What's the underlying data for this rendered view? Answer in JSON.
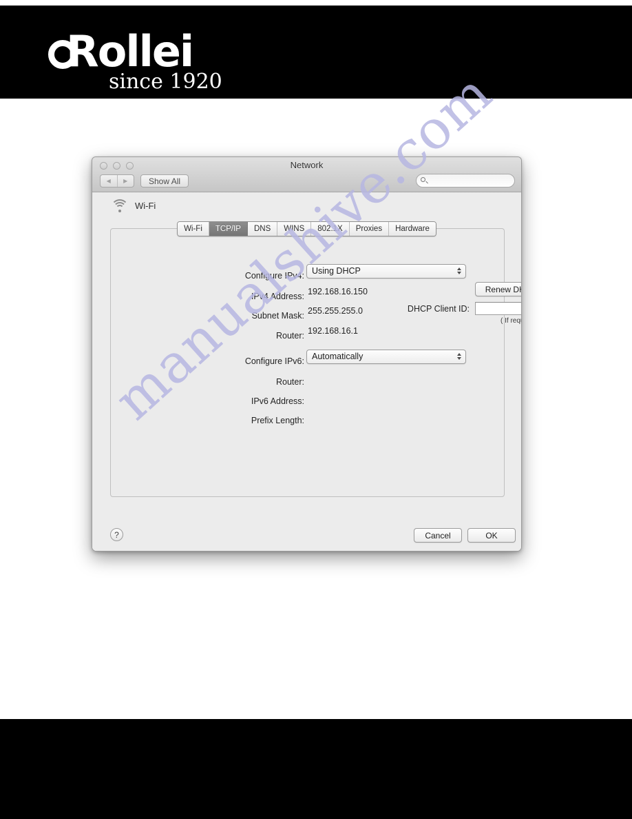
{
  "brand": {
    "logo_word": "Rollei",
    "logo_tagline": "since 1920"
  },
  "watermark": {
    "text": "manualshive.com",
    "color": "#b7b7e2"
  },
  "window": {
    "title": "Network",
    "traffic_lights": [
      "close",
      "minimize",
      "zoom"
    ],
    "toolbar": {
      "back_label": "◀",
      "forward_label": "▶",
      "show_all_label": "Show All",
      "search_value": "",
      "search_placeholder": ""
    },
    "service": {
      "name": "Wi-Fi",
      "icon": "wifi-icon"
    },
    "tabs": [
      {
        "label": "Wi-Fi",
        "active": false
      },
      {
        "label": "TCP/IP",
        "active": true
      },
      {
        "label": "DNS",
        "active": false
      },
      {
        "label": "WINS",
        "active": false
      },
      {
        "label": "802.1X",
        "active": false
      },
      {
        "label": "Proxies",
        "active": false
      },
      {
        "label": "Hardware",
        "active": false
      }
    ],
    "ipv4": {
      "configure_label": "Configure IPv4:",
      "configure_value": "Using DHCP",
      "address_label": "IPv4 Address:",
      "address_value": "192.168.16.150",
      "subnet_label": "Subnet Mask:",
      "subnet_value": "255.255.255.0",
      "router_label": "Router:",
      "router_value": "192.168.16.1",
      "renew_button": "Renew DHCP Lease",
      "client_id_label": "DHCP Client ID:",
      "client_id_value": "",
      "client_id_hint": "( If required )"
    },
    "ipv6": {
      "configure_label": "Configure IPv6:",
      "configure_value": "Automatically",
      "router_label": "Router:",
      "router_value": "",
      "address_label": "IPv6 Address:",
      "address_value": "",
      "prefix_label": "Prefix Length:",
      "prefix_value": ""
    },
    "footer": {
      "help_label": "?",
      "cancel_label": "Cancel",
      "ok_label": "OK"
    }
  }
}
